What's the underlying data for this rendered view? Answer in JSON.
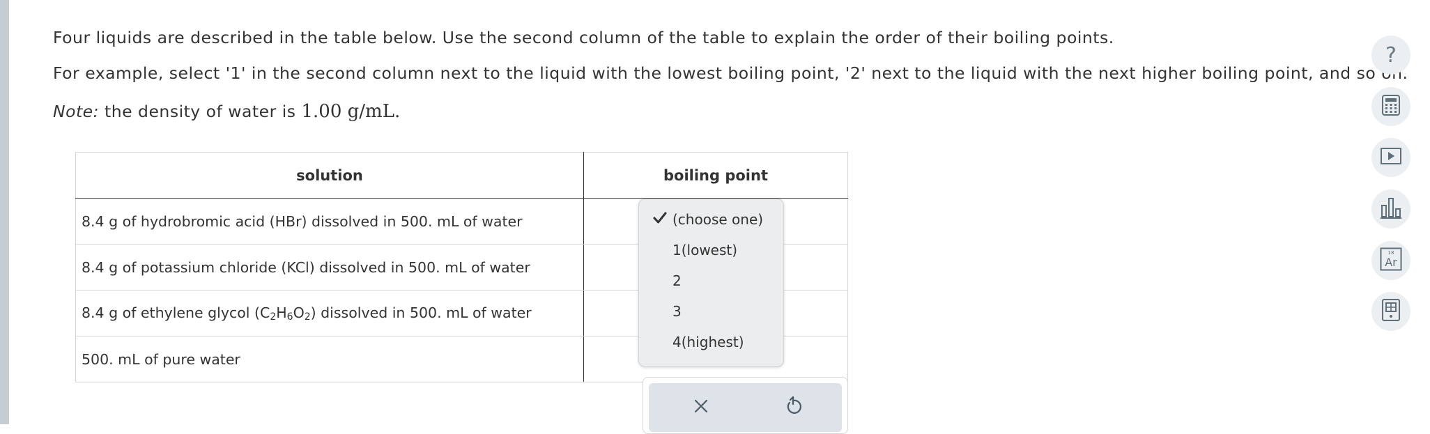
{
  "question": {
    "intro": "Four liquids are described in the table below. Use the second column of the table to explain the order of their boiling points.",
    "example": "For example, select '1' in the second column next to the liquid with the lowest boiling point, '2' next to the liquid with the next higher boiling point, and so on.",
    "note_label": "Note:",
    "note_text": " the density of water is ",
    "note_value": "1.00 g/mL."
  },
  "table": {
    "headers": [
      "solution",
      "boiling point"
    ],
    "rows": [
      {
        "pre": "8.4 g of hydrobromic acid (HBr) dissolved in 500. mL of water"
      },
      {
        "pre": "8.4 g of potassium chloride (KCl) dissolved in 500. mL of water"
      },
      {
        "pre": "8.4 g of ethylene glycol (C",
        "s1": "2",
        "m1": "H",
        "s2": "6",
        "m2": "O",
        "s3": "2",
        "post": ") dissolved in 500. mL of water"
      },
      {
        "pre": "500. mL of pure water"
      }
    ]
  },
  "dropdown": {
    "selected": "(choose one)",
    "options": [
      "(choose one)",
      "1(lowest)",
      "2",
      "3",
      "4(highest)"
    ]
  },
  "tools": {
    "help_glyph": "?",
    "periodic_number": "18",
    "periodic_symbol": "Ar"
  },
  "icons": [
    "help-icon",
    "calculator-icon",
    "video-icon",
    "bar-chart-icon",
    "periodic-table-icon",
    "reference-book-icon",
    "close-icon",
    "undo-icon",
    "checkmark-icon"
  ],
  "colors": {
    "text": "#333333",
    "sidebar": "#c5cdd3",
    "tool_bg": "#eceff1",
    "tool_icon": "#5f6f7a",
    "dropdown_bg": "#ebedee",
    "button_panel_bg": "#dde3e8"
  }
}
